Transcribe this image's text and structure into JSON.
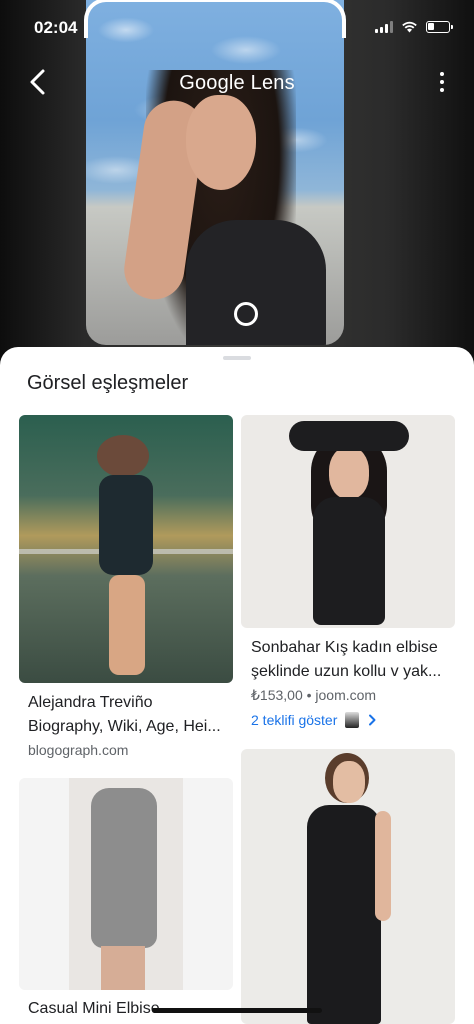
{
  "status_bar": {
    "time": "02:04"
  },
  "header": {
    "title": "Google Lens"
  },
  "sheet": {
    "title": "Görsel eşleşmeler"
  },
  "results": [
    {
      "title_line1": "Alejandra Treviño",
      "title_line2": "Biography, Wiki, Age, Hei...",
      "source": "blogograph.com"
    },
    {
      "title_line1": "Sonbahar Kış kadın elbise",
      "title_line2": "şeklinde uzun kollu v yak...",
      "price_source": "₺153,00 • joom.com",
      "offer_label": "2 teklifi göster"
    },
    {
      "title_line1": "Casual Mini Elbise"
    },
    {}
  ],
  "colors": {
    "accent": "#1a73e8",
    "sheet_bg": "#ffffff",
    "text": "#202124",
    "muted": "#5f6368"
  },
  "icons": [
    "back-arrow-icon",
    "more-vert-icon",
    "shutter-icon",
    "chevron-right-icon",
    "wifi-icon",
    "signal-icon",
    "battery-icon"
  ]
}
